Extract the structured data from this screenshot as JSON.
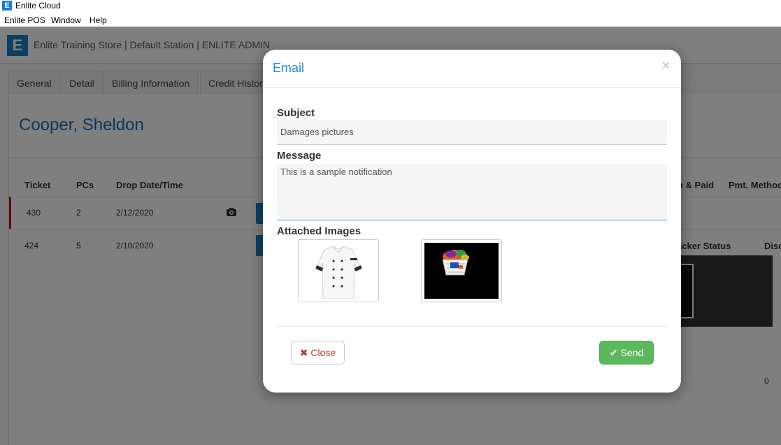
{
  "window": {
    "title": "Enlite Cloud",
    "app_icon_letter": "E"
  },
  "menu": {
    "items": [
      "Enlite POS",
      "Window",
      "Help"
    ]
  },
  "header": {
    "logo_letter": "E",
    "store_text": "Enlite Training Store | Default Station | ENLITE ADMIN"
  },
  "tabs": [
    "General",
    "Detail",
    "Billing Information",
    "Credit History"
  ],
  "customer_name": "Cooper, Sheldon",
  "table": {
    "headers": [
      "Ticket",
      "PCs",
      "Drop Date/Time"
    ],
    "right_headers": [
      "p & Paid",
      "Pmt. Method"
    ],
    "right_header2": "acker Status",
    "right_header3": "Disc",
    "rows": [
      {
        "ticket": "430",
        "pcs": "2",
        "date": "2/12/2020",
        "right_value": ""
      },
      {
        "ticket": "424",
        "pcs": "5",
        "date": "2/10/2020",
        "right_value": "0"
      }
    ],
    "extra_value": "0"
  },
  "modal": {
    "title": "Email",
    "close_symbol": "×",
    "subject_label": "Subject",
    "subject_value": "Damages pictures",
    "message_label": "Message",
    "message_value": "This is a sample notification",
    "attached_label": "Attached Images",
    "images": [
      "chef-jacket-image",
      "laundry-basket-image"
    ],
    "close_button": {
      "icon": "✖",
      "label": "Close"
    },
    "send_button": {
      "icon": "✔",
      "label": "Send"
    }
  },
  "colors": {
    "brand_blue": "#1a7fc4",
    "title_blue": "#2a8ad8",
    "send_green": "#5cb85c",
    "close_red": "#c0392b",
    "active_row_marker": "#cc0000"
  }
}
